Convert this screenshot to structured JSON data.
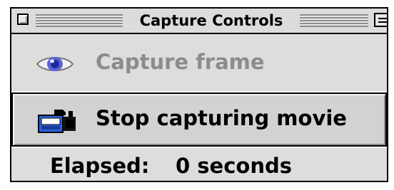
{
  "window": {
    "title": "Capture Controls",
    "close_box_icon": "close-box-icon",
    "collapse_box_icon": "collapse-box-icon"
  },
  "capture_frame": {
    "label": "Capture frame",
    "icon": "eye-icon",
    "enabled": false
  },
  "stop_capture": {
    "label": "Stop capturing movie",
    "icon": "video-camera-icon",
    "pressed": true
  },
  "elapsed": {
    "label": "Elapsed:",
    "value": "0 seconds"
  },
  "colors": {
    "window_bg": "#dcdcdc",
    "disabled_text": "#8c8c8c",
    "eye_blue": "#3c46c8",
    "camera_blue": "#2a64e0"
  }
}
